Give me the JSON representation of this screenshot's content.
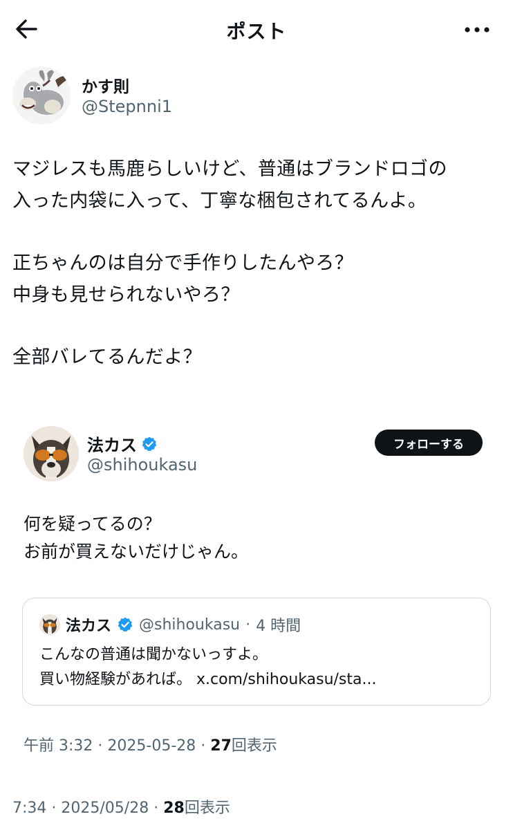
{
  "header": {
    "title": "ポスト"
  },
  "post": {
    "author_name": "かす則",
    "author_handle": "@Stepnni1",
    "lines": [
      "マジレスも馬鹿らしいけど、普通はブランドロゴの",
      "入った内袋に入って、丁寧な梱包されてるんよ。",
      "正ちゃんのは自分で手作りしたんやろ？",
      "中身も見せられないやろ？",
      "全部バレてるんだよ？"
    ],
    "time": "7:34",
    "date": "2025/05/28",
    "views_count": "28",
    "views_label": "回表示"
  },
  "embedded": {
    "author_name": "法カス",
    "author_handle": "@shihoukasu",
    "follow_label": "フォローする",
    "lines": [
      "何を疑ってるの？",
      "お前が買えないだけじゃん。"
    ],
    "time": "午前 3:32",
    "date": "2025-05-28",
    "views_count": "27",
    "views_label": "回表示",
    "quote": {
      "author_name": "法カス",
      "author_handle": "@shihoukasu",
      "age": "4 時間",
      "lines": [
        "こんなの普通は聞かないっすよ。",
        "買い物経験があれば。 x.com/shihoukasu/sta..."
      ]
    }
  },
  "colors": {
    "text": "#0f1419",
    "secondary": "#536471",
    "verified": "#1d9bf0",
    "border": "#cfd9de",
    "button_bg": "#0f1419"
  },
  "icons": [
    "arrow-left-icon",
    "more-horizontal-icon",
    "verified-badge-icon"
  ]
}
